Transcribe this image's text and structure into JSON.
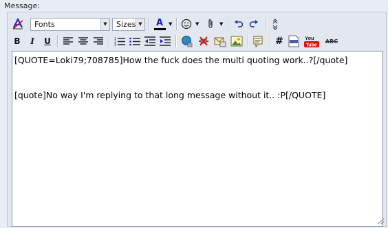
{
  "label": "Message:",
  "toolbar": {
    "font_select": "Fonts",
    "size_select": "Sizes",
    "bold": "B",
    "italic": "I",
    "underline": "U",
    "hash": "#",
    "youtube": "You Tube",
    "strike": "ABC",
    "text_color_letter": "A",
    "text_color": "#1a1acc",
    "text_color_bar": "#000000"
  },
  "editor": {
    "content": "[QUOTE=Loki79;708785]How the fuck does the multi quoting work..?[/quote]\n\n\n[quote]No way I'm replying to that long message without it.. :P[/QUOTE]"
  }
}
